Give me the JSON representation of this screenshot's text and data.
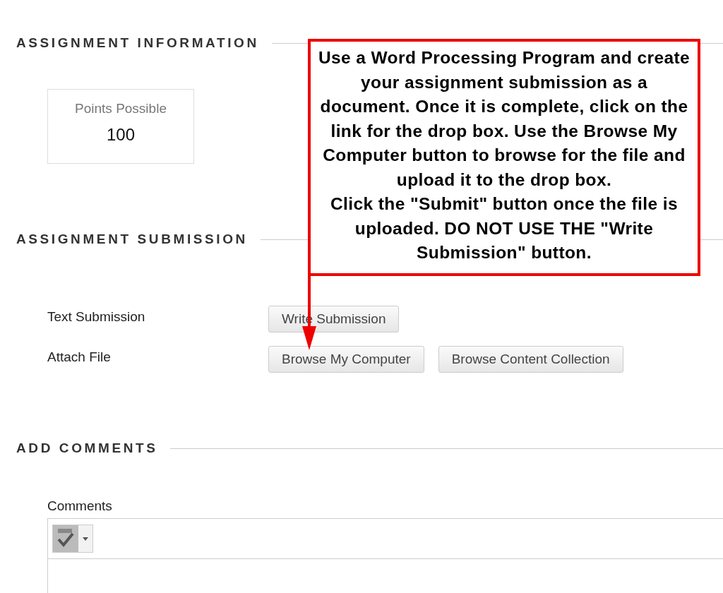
{
  "sections": [
    {
      "kind": "info",
      "title": "ASSIGNMENT INFORMATION",
      "points": {
        "label": "Points Possible",
        "value": "100"
      }
    },
    {
      "kind": "submission",
      "title": "ASSIGNMENT SUBMISSION",
      "rows": [
        {
          "label": "Text Submission",
          "buttons": [
            "Write Submission"
          ]
        },
        {
          "label": "Attach File",
          "buttons": [
            "Browse My Computer",
            "Browse Content Collection"
          ]
        }
      ]
    },
    {
      "kind": "comments",
      "title": "ADD COMMENTS",
      "field_label": "Comments"
    }
  ],
  "callout": {
    "paragraphs": [
      "Use a Word Processing Program and create your assignment submission as a document.  Once it is complete, click on the link for the drop box.  Use the Browse My Computer button to browse for the file and upload it to the drop box.",
      "Click the \"Submit\" button once the file is uploaded.  DO NOT USE THE \"Write Submission\" button."
    ]
  }
}
